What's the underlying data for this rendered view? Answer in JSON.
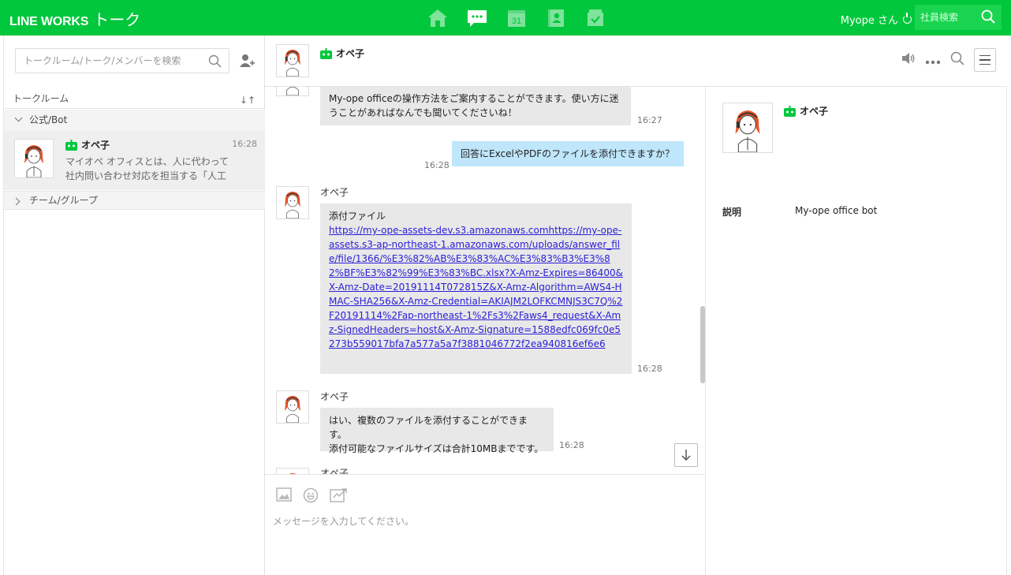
{
  "header": {
    "logo": "LINE WORKS",
    "app_name": "トーク",
    "nav": [
      "home-icon",
      "talk-icon",
      "calendar-icon",
      "contacts-icon",
      "task-icon"
    ],
    "calendar_day": "31",
    "user_name": "Myope さん",
    "employee_search_placeholder": "社員検索"
  },
  "sidebar": {
    "search_placeholder": "トークルーム/トーク/メンバーを検索",
    "section_label": "トークルーム",
    "group_bot_label": "公式/Bot",
    "group_team_label": "チーム/グループ",
    "room": {
      "name": "オペ子",
      "time": "16:28",
      "preview": "マイオペ オフィスとは、人に代わって社内問い合わせ対応を担当する「人工"
    }
  },
  "chat": {
    "title": "オペ子",
    "messages": [
      {
        "text": "My-ope officeの操作方法をご案内することができます。使い方に迷うことがあればなんでも聞いてくださいね！",
        "time": "16:27"
      },
      {
        "text": "回答にExcelやPDFのファイルを添付できますか？",
        "time": "16:28"
      },
      {
        "sender": "オペ子",
        "text": "添付ファイル",
        "link": "https://my-ope-assets-dev.s3.amazonaws.comhttps://my-ope-assets.s3-ap-northeast-1.amazonaws.com/uploads/answer_file/file/1366/%E3%82%AB%E3%83%AC%E3%83%B3%E3%82%BF%E3%82%99%E3%83%BC.xlsx?X-Amz-Expires=86400&X-Amz-Date=20191114T072815Z&X-Amz-Algorithm=AWS4-HMAC-SHA256&X-Amz-Credential=AKIAJM2LOFKCMNJS3C7Q%2F20191114%2Fap-northeast-1%2Fs3%2Faws4_request&X-Amz-SignedHeaders=host&X-Amz-Signature=1588edfc069fc0e5273b559017bfa7a577a5a7f3881046772f2ea940816ef6e6",
        "time": "16:28"
      },
      {
        "sender": "オペ子",
        "line1": "はい、複数のファイルを添付することができます。",
        "line2": "添付可能なファイルサイズは合計10MBまでです。",
        "time": "16:28"
      },
      {
        "sender": "オペ子"
      }
    ],
    "composer_placeholder": "メッセージを入力してください。"
  },
  "profile": {
    "name": "オペ子",
    "desc_label": "説明",
    "desc_value": "My-ope office bot"
  },
  "colors": {
    "brand": "#00c73c",
    "bubble_in": "#e8e8e8",
    "bubble_out": "#bfe6fb",
    "link": "#2c20d8"
  }
}
